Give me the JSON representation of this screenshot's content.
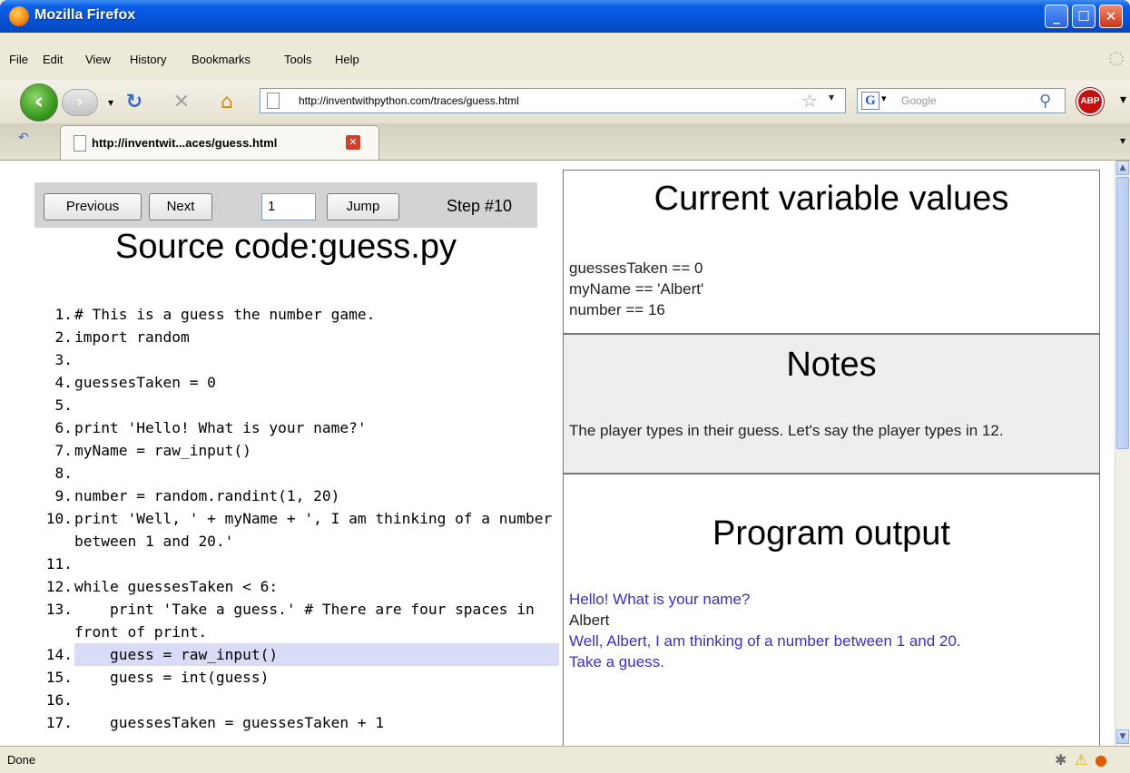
{
  "window": {
    "title": "Mozilla Firefox"
  },
  "menu": [
    "File",
    "Edit",
    "View",
    "History",
    "Bookmarks",
    "Tools",
    "Help"
  ],
  "toolbar": {
    "url": "http://inventwithpython.com/traces/guess.html",
    "search_placeholder": "Google",
    "search_engine_glyph": "G",
    "addon_badge": "ABP"
  },
  "tabs": [
    {
      "label": "http://inventwit...aces/guess.html"
    }
  ],
  "trace": {
    "buttons": {
      "previous": "Previous",
      "next": "Next",
      "jump": "Jump"
    },
    "step_input": "1",
    "step_label": "Step #10",
    "source_title": "Source code:guess.py",
    "highlighted_line": 14,
    "code": [
      {
        "num": "1.",
        "text": "# This is a guess the number game."
      },
      {
        "num": "2.",
        "text": "import random"
      },
      {
        "num": "3.",
        "text": ""
      },
      {
        "num": "4.",
        "text": "guessesTaken = 0"
      },
      {
        "num": "5.",
        "text": ""
      },
      {
        "num": "6.",
        "text": "print 'Hello! What is your name?'"
      },
      {
        "num": "7.",
        "text": "myName = raw_input()"
      },
      {
        "num": "8.",
        "text": ""
      },
      {
        "num": "9.",
        "text": "number = random.randint(1, 20)"
      },
      {
        "num": "10.",
        "text": "print 'Well, ' + myName + ', I am thinking of a number between 1 and 20.'"
      },
      {
        "num": "11.",
        "text": ""
      },
      {
        "num": "12.",
        "text": "while guessesTaken < 6:"
      },
      {
        "num": "13.",
        "text": "    print 'Take a guess.' # There are four spaces in front of print."
      },
      {
        "num": "14.",
        "text": "    guess = raw_input()"
      },
      {
        "num": "15.",
        "text": "    guess = int(guess)"
      },
      {
        "num": "16.",
        "text": ""
      },
      {
        "num": "17.",
        "text": "    guessesTaken = guessesTaken + 1"
      }
    ],
    "variables_title": "Current variable values",
    "variables": [
      "guessesTaken == 0",
      "myName == 'Albert'",
      "number == 16"
    ],
    "notes_title": "Notes",
    "notes": "The player types in their guess. Let's say the player types in 12.",
    "output_title": "Program output",
    "output": [
      {
        "text": "Hello! What is your name?",
        "kind": "prog"
      },
      {
        "text": "Albert",
        "kind": "user"
      },
      {
        "text": "Well, Albert, I am thinking of a number between 1 and 20.",
        "kind": "prog"
      },
      {
        "text": "Take a guess.",
        "kind": "prog"
      }
    ]
  },
  "status": {
    "text": "Done"
  },
  "colors": {
    "program_output": "#3b2fc2",
    "highlight": "#d9dcf8",
    "titlebar": "#0553d6"
  }
}
